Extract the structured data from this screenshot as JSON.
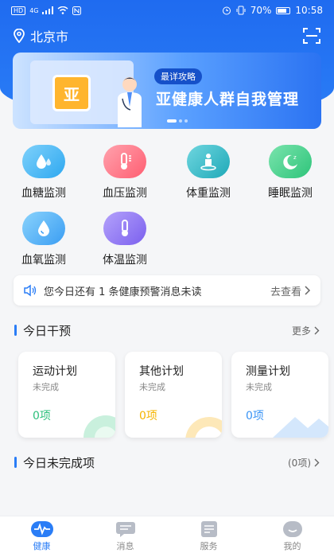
{
  "status_bar": {
    "left_badge": "HD",
    "signal_label": "4G",
    "battery": "70%",
    "time": "10:58"
  },
  "header": {
    "city": "北京市"
  },
  "banner": {
    "logo_char": "亚",
    "tag": "最详攻略",
    "title": "亚健康人群自我管理"
  },
  "monitors": [
    {
      "label": "血糖监测",
      "color": "#3bb0f2"
    },
    {
      "label": "血压监测",
      "color": "#ff6c7d"
    },
    {
      "label": "体重监测",
      "color": "#2fb7c5"
    },
    {
      "label": "睡眠监测",
      "color": "#3ecb86"
    },
    {
      "label": "血氧监测",
      "color": "#43a7f5"
    },
    {
      "label": "体温监测",
      "color": "#8a6ff0"
    }
  ],
  "alert": {
    "text": "您今日还有 1 条健康预警消息未读",
    "link": "去查看"
  },
  "today_intervention": {
    "title": "今日干预",
    "more": "更多",
    "plans": [
      {
        "title": "运动计划",
        "status": "未完成",
        "count": "0项",
        "color": "#2ec07c"
      },
      {
        "title": "其他计划",
        "status": "未完成",
        "count": "0项",
        "color": "#f5b400"
      },
      {
        "title": "测量计划",
        "status": "未完成",
        "count": "0项",
        "color": "#3a94f5"
      }
    ]
  },
  "today_incomplete": {
    "title": "今日未完成项",
    "count": "(0项)"
  },
  "tabs": [
    {
      "label": "健康",
      "active": true
    },
    {
      "label": "消息",
      "active": false
    },
    {
      "label": "服务",
      "active": false
    },
    {
      "label": "我的",
      "active": false
    }
  ]
}
